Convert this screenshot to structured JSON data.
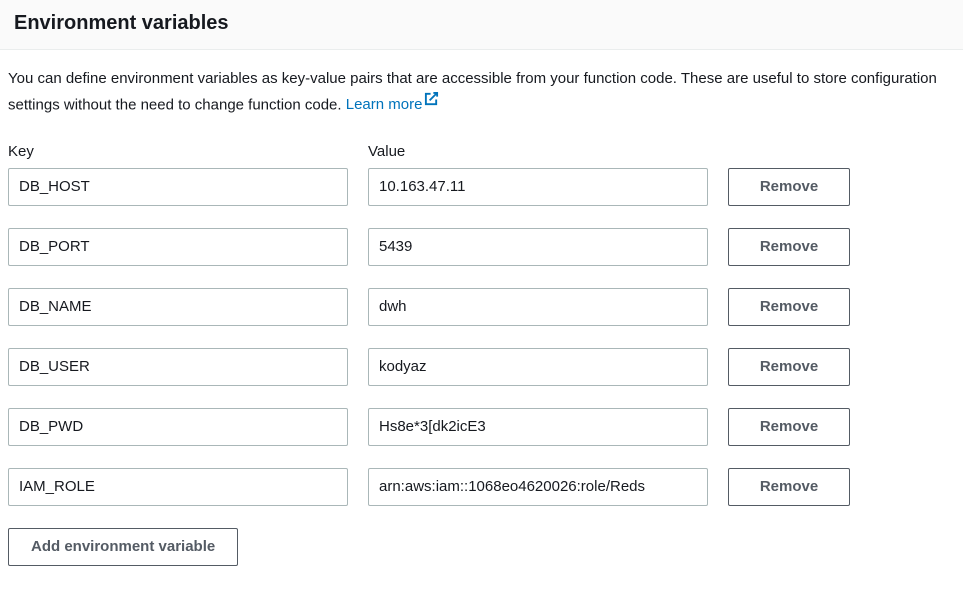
{
  "header": {
    "title": "Environment variables"
  },
  "description": {
    "text": "You can define environment variables as key-value pairs that are accessible from your function code. These are useful to store configuration settings without the need to change function code. ",
    "learn_more": "Learn more"
  },
  "columns": {
    "key": "Key",
    "value": "Value"
  },
  "remove_label": "Remove",
  "add_label": "Add environment variable",
  "variables": [
    {
      "key": "DB_HOST",
      "value": "10.163.47.11"
    },
    {
      "key": "DB_PORT",
      "value": "5439"
    },
    {
      "key": "DB_NAME",
      "value": "dwh"
    },
    {
      "key": "DB_USER",
      "value": "kodyaz"
    },
    {
      "key": "DB_PWD",
      "value": "Hs8e*3[dk2icE3"
    },
    {
      "key": "IAM_ROLE",
      "value": "arn:aws:iam::1068eo4620026:role/Reds"
    }
  ]
}
